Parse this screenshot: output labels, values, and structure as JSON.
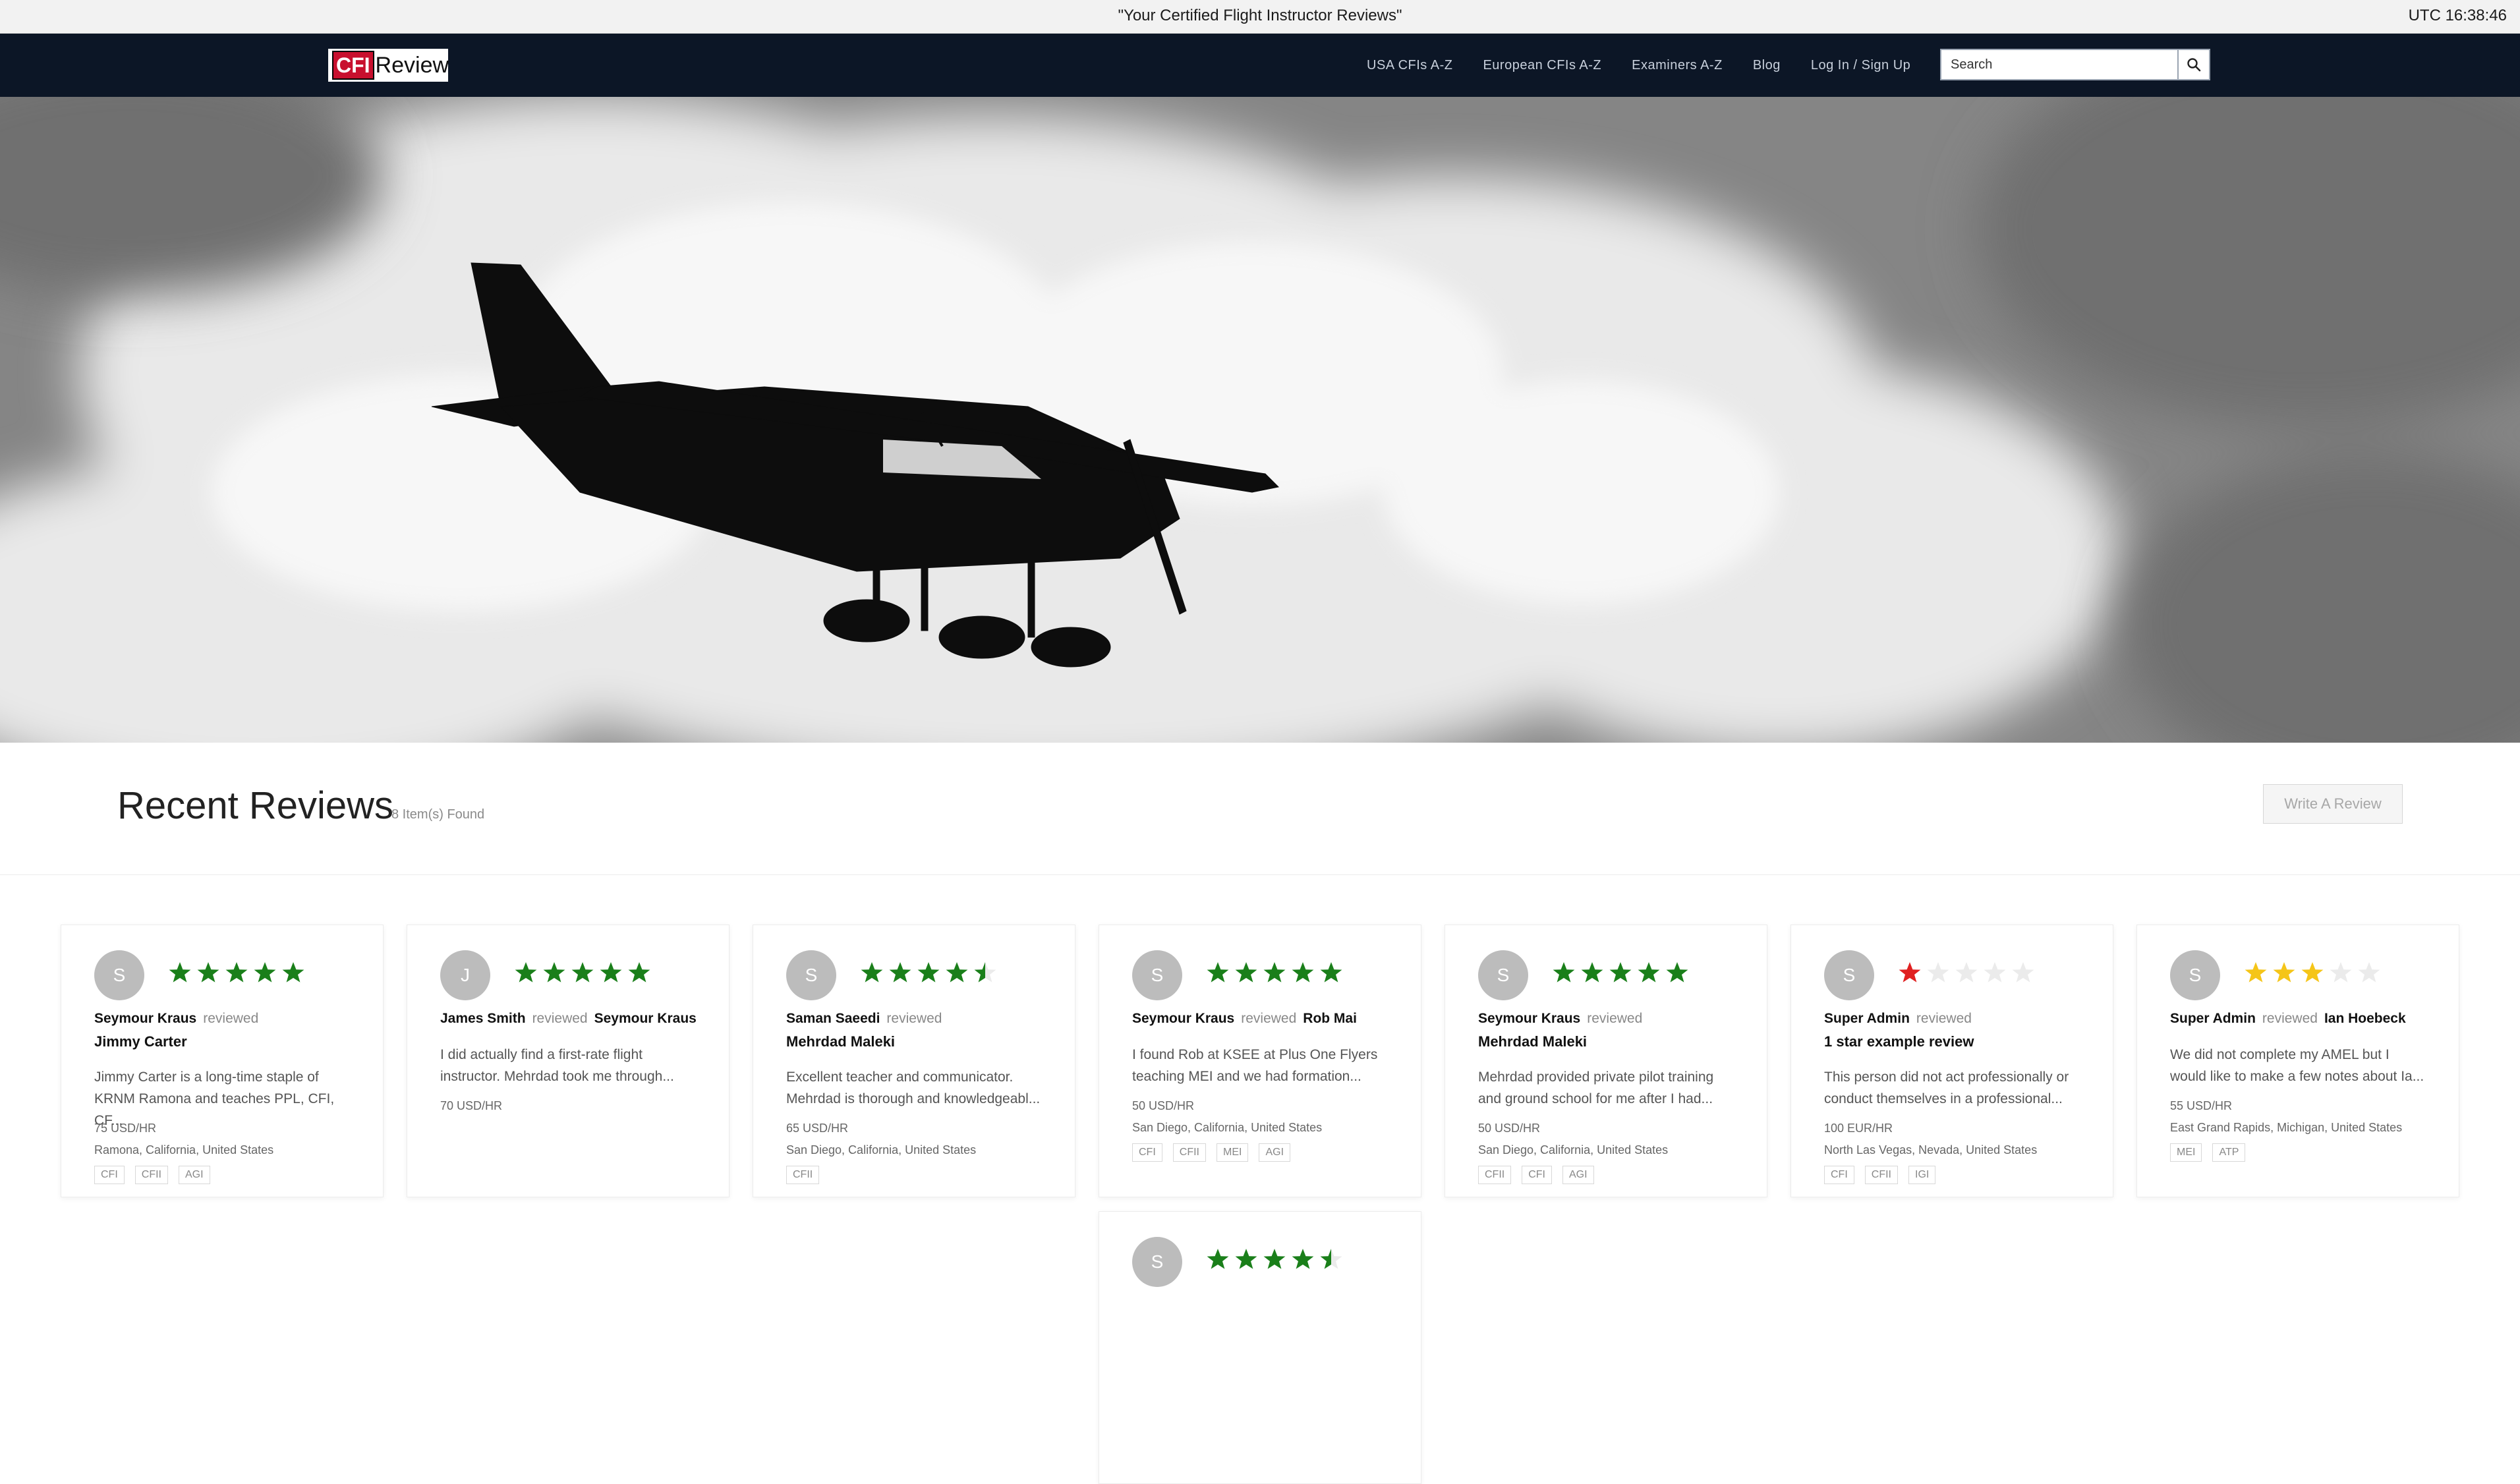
{
  "system_bar": {
    "title": "\"Your Certified Flight Instructor Reviews\"",
    "clock": "UTC 16:38:46"
  },
  "nav": {
    "logo_cfi": "CFI",
    "logo_review": "Review",
    "links": [
      "USA CFIs A-Z",
      "European CFIs A-Z",
      "Examiners A-Z",
      "Blog",
      "Log In / Sign Up"
    ],
    "search_placeholder": "Search"
  },
  "section": {
    "title": "Recent Reviews",
    "count": "8 Item(s) Found",
    "write_button": "Write A Review"
  },
  "colors": {
    "navbar": "#0c1626",
    "star_green": "#1a7f1a",
    "star_red": "#e02020",
    "star_yellow": "#f5c518",
    "star_empty": "#ebebeb"
  },
  "reviews": [
    {
      "avatar": "S",
      "rating": 5,
      "star_color": "green",
      "reviewer": "Seymour Kraus",
      "verb": "reviewed",
      "target": "",
      "subject": "Jimmy Carter",
      "excerpt": "Jimmy Carter is a long-time staple of KRNM Ramona and teaches PPL, CFI, CF...",
      "rate": "75 USD/HR",
      "location": "Ramona, California, United States",
      "tags": [
        "CFI",
        "CFII",
        "AGI"
      ]
    },
    {
      "avatar": "J",
      "rating": 5,
      "star_color": "green",
      "reviewer": "James Smith",
      "verb": "reviewed",
      "target": "Seymour Kraus",
      "subject": "",
      "excerpt": "I did actually find a first-rate flight instructor. Mehrdad took me through...",
      "rate": "70 USD/HR",
      "location": "",
      "tags": []
    },
    {
      "avatar": "S",
      "rating": 4.5,
      "star_color": "green",
      "reviewer": "Saman Saeedi",
      "verb": "reviewed",
      "target": "",
      "subject": "Mehrdad Maleki",
      "excerpt": "Excellent teacher and communicator. Mehrdad is thorough and knowledgeabl...",
      "rate": "65 USD/HR",
      "location": "San Diego, California, United States",
      "tags": [
        "CFII"
      ]
    },
    {
      "avatar": "S",
      "rating": 5,
      "star_color": "green",
      "reviewer": "Seymour Kraus",
      "verb": "reviewed",
      "target": "Rob Mai",
      "subject": "",
      "excerpt": "I found Rob at KSEE at Plus One Flyers teaching MEI and we had formation...",
      "rate": "50 USD/HR",
      "location": "San Diego, California, United States",
      "tags": [
        "CFI",
        "CFII",
        "MEI",
        "AGI"
      ]
    },
    {
      "avatar": "S",
      "rating": 5,
      "star_color": "green",
      "reviewer": "Seymour Kraus",
      "verb": "reviewed",
      "target": "",
      "subject": "Mehrdad Maleki",
      "excerpt": "Mehrdad provided private pilot training and ground school for me after I had...",
      "rate": "50 USD/HR",
      "location": "San Diego, California, United States",
      "tags": [
        "CFII",
        "CFI",
        "AGI"
      ]
    },
    {
      "avatar": "S",
      "rating": 1,
      "star_color": "red",
      "reviewer": "Super Admin",
      "verb": "reviewed",
      "target": "",
      "subject": "1 star example review",
      "excerpt": "This person did not act professionally or conduct themselves in a professional...",
      "rate": "100 EUR/HR",
      "location": "North Las Vegas, Nevada, United States",
      "tags": [
        "CFI",
        "CFII",
        "IGI"
      ]
    },
    {
      "avatar": "S",
      "rating": 3,
      "star_color": "yellow",
      "reviewer": "Super Admin",
      "verb": "reviewed",
      "target": "Ian Hoebeck",
      "subject": "",
      "excerpt": "We did not complete my AMEL but I would like to make a few notes about Ia...",
      "rate": "55 USD/HR",
      "location": "East Grand Rapids, Michigan, United States",
      "tags": [
        "MEI",
        "ATP"
      ]
    },
    {
      "avatar": "S",
      "rating": 4.5,
      "star_color": "green",
      "reviewer": "",
      "verb": "",
      "target": "",
      "subject": "",
      "excerpt": "",
      "rate": "",
      "location": "",
      "tags": []
    }
  ]
}
